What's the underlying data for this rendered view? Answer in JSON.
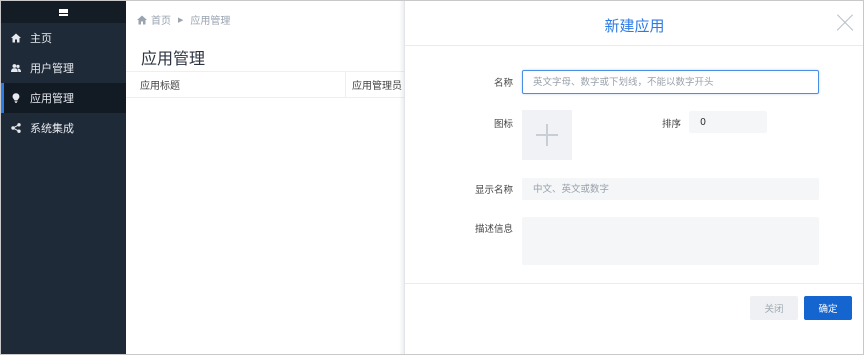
{
  "sidebar": {
    "menu_icon": "hamburger-menu-icon",
    "items": [
      {
        "label": "主页",
        "icon": "home-icon",
        "active": false
      },
      {
        "label": "用户管理",
        "icon": "users-icon",
        "active": false
      },
      {
        "label": "应用管理",
        "icon": "lightbulb-icon",
        "active": true
      },
      {
        "label": "系统集成",
        "icon": "share-icon",
        "active": false
      }
    ]
  },
  "breadcrumb": {
    "home_icon": "home-icon",
    "home": "首页",
    "separator": "▶",
    "current": "应用管理"
  },
  "page": {
    "title": "应用管理",
    "columns": [
      "应用标题",
      "应用管理员"
    ]
  },
  "modal": {
    "title": "新建应用",
    "fields": {
      "name_label": "名称",
      "name_placeholder": "英文字母、数字或下划线，不能以数字开头",
      "icon_label": "图标",
      "sort_label": "排序",
      "sort_value": "0",
      "display_label": "显示名称",
      "display_placeholder": "中文、英文或数字",
      "desc_label": "描述信息",
      "desc_value": ""
    },
    "buttons": {
      "close": "关闭",
      "ok": "确定"
    }
  },
  "colors": {
    "sidebar_bg": "#1f2a38",
    "accent": "#2d7be5",
    "primary_button": "#1565d1"
  }
}
